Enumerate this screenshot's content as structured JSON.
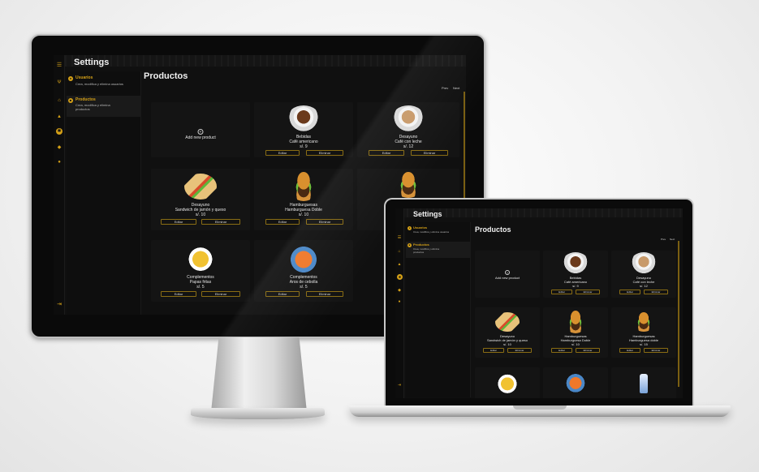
{
  "app": {
    "header_title": "Settings",
    "section_title": "Productos",
    "pagination": {
      "prev": "Prev",
      "next": "Next"
    },
    "menu": [
      {
        "title": "Usuarios",
        "desc": "Crea, modifica y elimina usuarios"
      },
      {
        "title": "Productos",
        "desc": "Crea, modifica y elimina productos"
      }
    ],
    "rail_icons": [
      "menu-icon",
      "home-icon",
      "receipt-icon",
      "bell-icon",
      "settings-icon",
      "tag-icon",
      "user-icon",
      "logout-icon"
    ],
    "add_product_label": "Add new product",
    "edit_label": "Editar",
    "delete_label": "Eliminar",
    "products": [
      {
        "category": "Bebidas",
        "name": "Café americano",
        "price": "s/. 9"
      },
      {
        "category": "Desayuno",
        "name": "Café con leche",
        "price": "s/. 12"
      },
      {
        "category": "Desayuno",
        "name": "Sandwich de jamón y queso",
        "price": "s/. 10"
      },
      {
        "category": "Hamburguesas",
        "name": "Hamburguesa Doble",
        "price": "s/. 10"
      },
      {
        "category": "Hamburguesas",
        "name": "Hamburguesa doble",
        "price": "s/. 15"
      },
      {
        "category": "Complementos",
        "name": "Papas fritas",
        "price": "s/. 5"
      },
      {
        "category": "Complementos",
        "name": "Aros de cebolla",
        "price": "s/. 5"
      }
    ],
    "accent_color": "#d4a017",
    "background_color": "#101010"
  }
}
